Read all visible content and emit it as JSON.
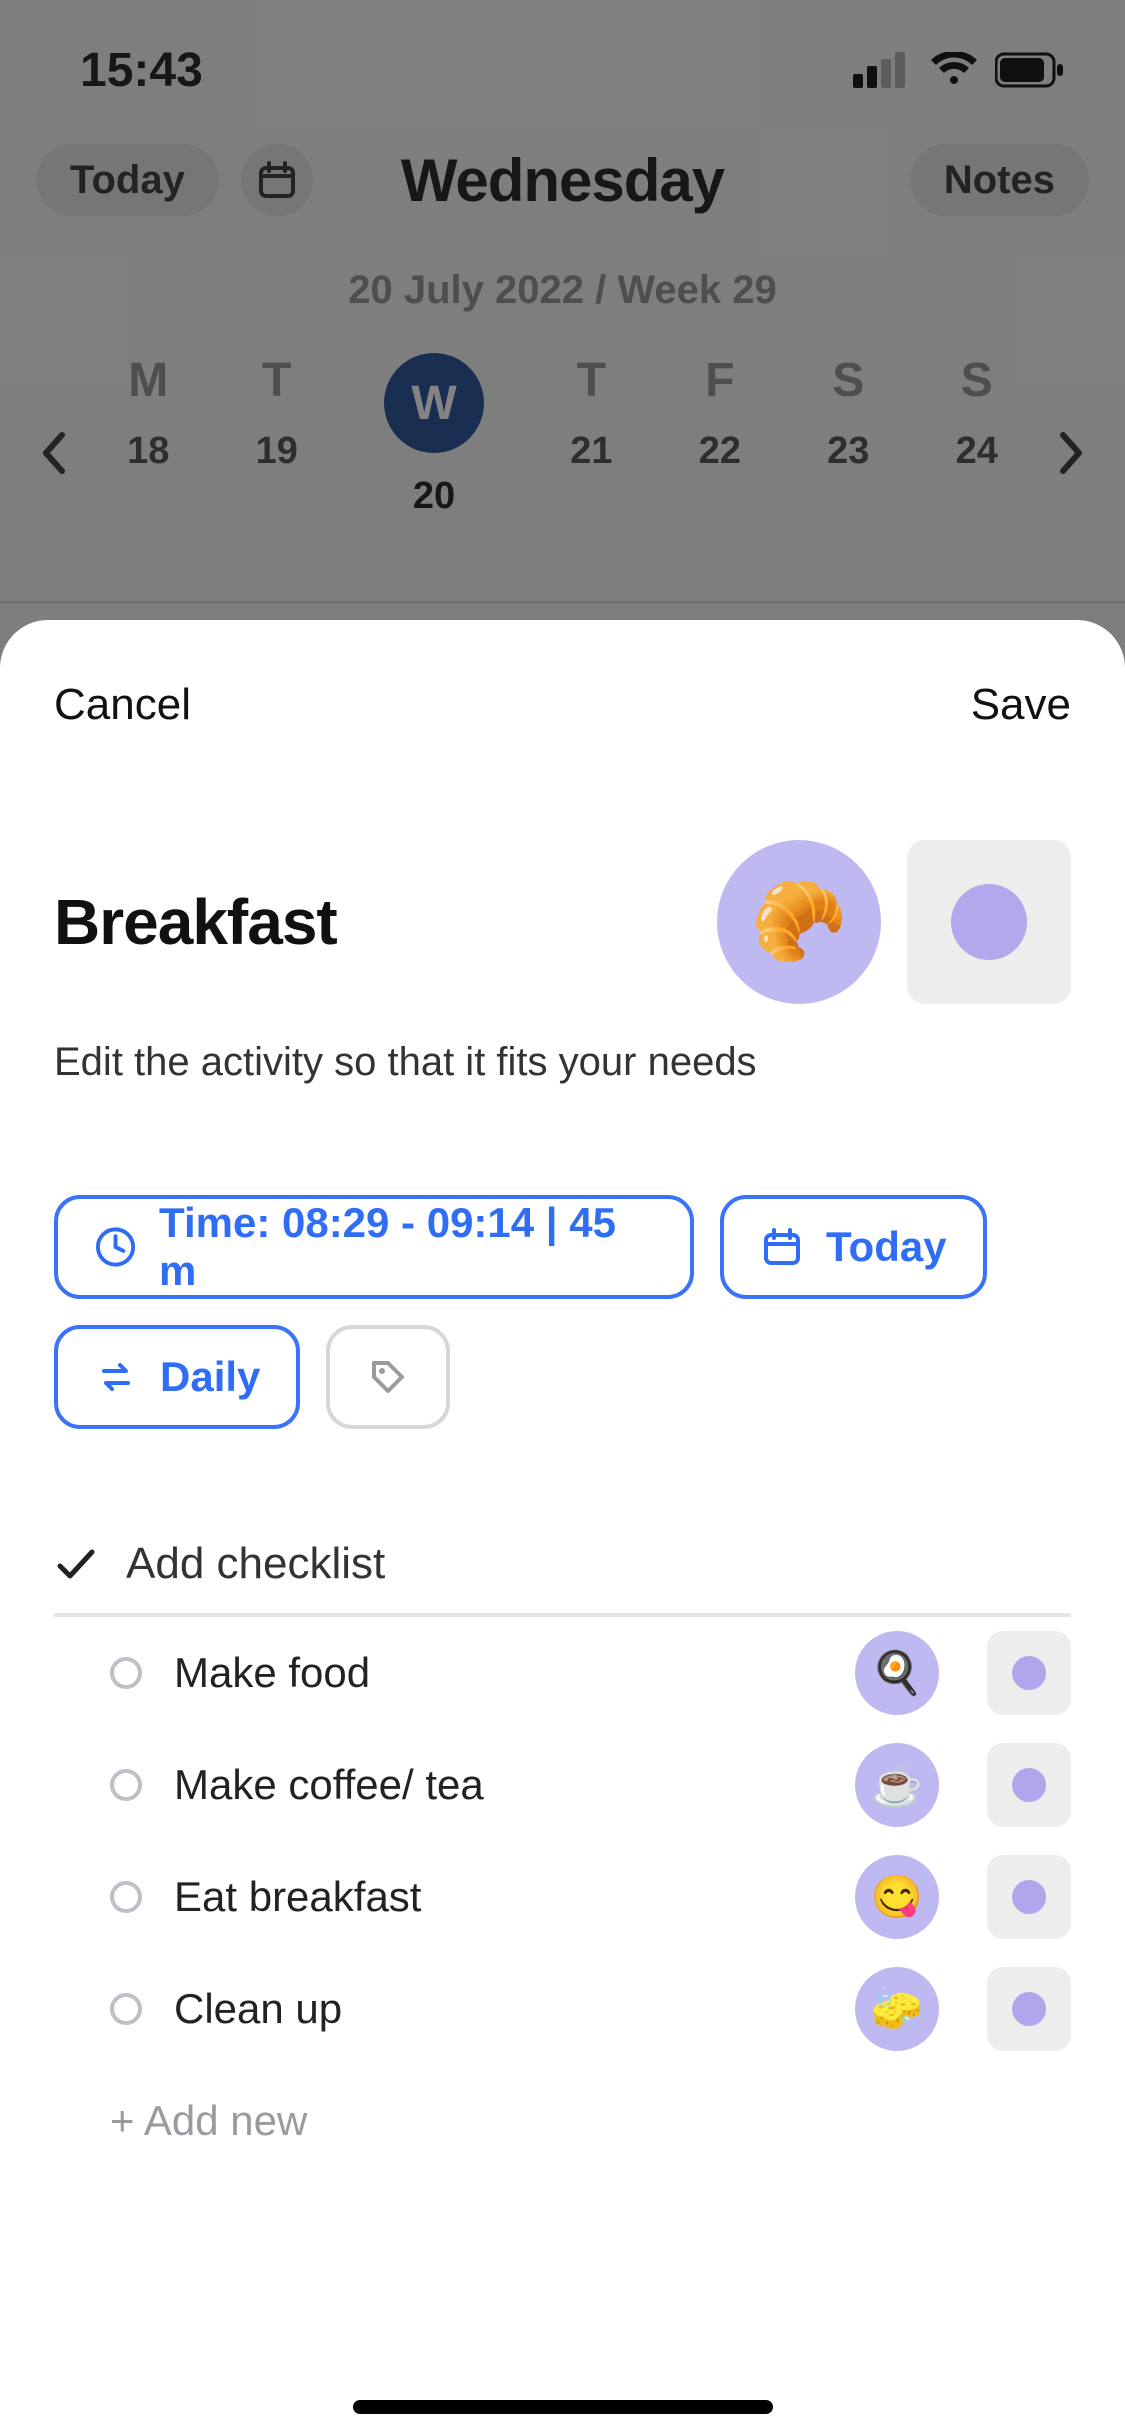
{
  "status": {
    "time": "15:43"
  },
  "header": {
    "today_label": "Today",
    "day_name": "Wednesday",
    "notes_label": "Notes",
    "subdate": "20 July 2022 / Week 29"
  },
  "week": {
    "days": [
      {
        "abbr": "M",
        "num": "18"
      },
      {
        "abbr": "T",
        "num": "19"
      },
      {
        "abbr": "W",
        "num": "20"
      },
      {
        "abbr": "T",
        "num": "21"
      },
      {
        "abbr": "F",
        "num": "22"
      },
      {
        "abbr": "S",
        "num": "23"
      },
      {
        "abbr": "S",
        "num": "24"
      }
    ],
    "selected_index": 2
  },
  "sheet": {
    "cancel": "Cancel",
    "save": "Save",
    "title": "Breakfast",
    "emoji": "🥐",
    "desc": "Edit the activity so that it fits your needs",
    "time_label": "Time: 08:29 - 09:14  |  45 m",
    "date_label": "Today",
    "recur_label": "Daily",
    "checklist_header": "Add checklist",
    "items": [
      {
        "label": "Make food",
        "emoji": "🍳"
      },
      {
        "label": "Make coffee/ tea",
        "emoji": "☕"
      },
      {
        "label": "Eat breakfast",
        "emoji": "😋"
      },
      {
        "label": "Clean up",
        "emoji": "🧽"
      }
    ],
    "add_new": "+ Add new"
  }
}
